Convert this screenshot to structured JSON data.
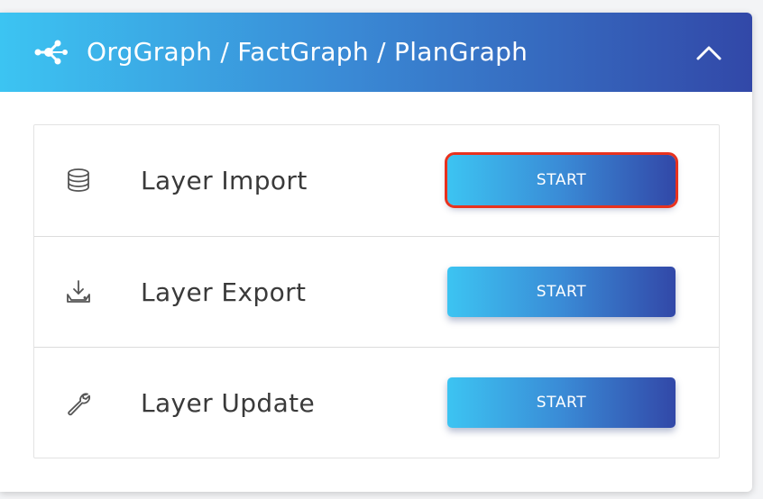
{
  "header": {
    "title": "OrgGraph / FactGraph / PlanGraph",
    "icon": "graph-nodes-icon",
    "collapse_icon": "chevron-up-icon"
  },
  "rows": [
    {
      "label": "Layer Import",
      "icon": "database-icon",
      "button_label": "START"
    },
    {
      "label": "Layer Export",
      "icon": "download-tray-icon",
      "button_label": "START"
    },
    {
      "label": "Layer Update",
      "icon": "wrench-icon",
      "button_label": "START"
    }
  ],
  "colors": {
    "gradient_start": "#3cc4f2",
    "gradient_end": "#3248a8",
    "highlight": "#e8321e"
  }
}
